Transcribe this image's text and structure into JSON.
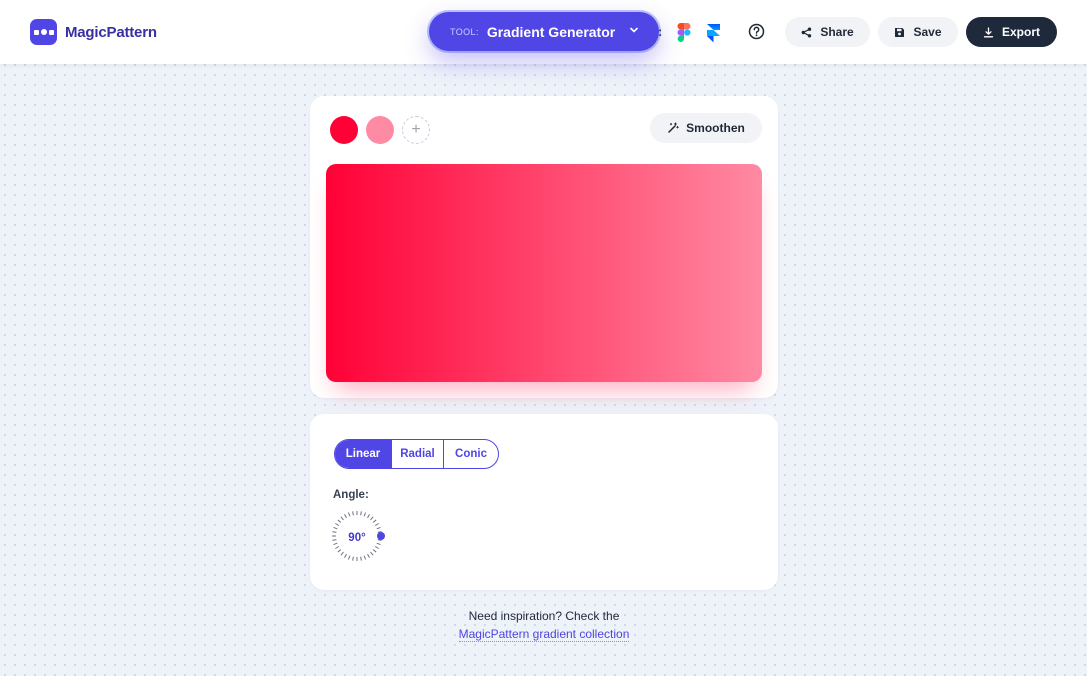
{
  "header": {
    "logo_text": "MagicPattern",
    "tool_prefix": "TOOL:",
    "tool_name": "Gradient Generator",
    "colon": ":",
    "share_label": "Share",
    "save_label": "Save",
    "export_label": "Export"
  },
  "editor": {
    "colors": [
      "#ff0137",
      "#ff8aa3"
    ],
    "add_symbol": "+",
    "smoothen_label": "Smoothen"
  },
  "settings": {
    "types": [
      "Linear",
      "Radial",
      "Conic"
    ],
    "selected_type": "Linear",
    "angle_label": "Angle:",
    "angle_value": "90°",
    "angle_degrees": 90
  },
  "footer": {
    "inspire_text": "Need inspiration? Check the",
    "inspire_link": "MagicPattern gradient collection"
  },
  "colors": {
    "accent": "#4f46e5",
    "dark": "#1e293b"
  }
}
